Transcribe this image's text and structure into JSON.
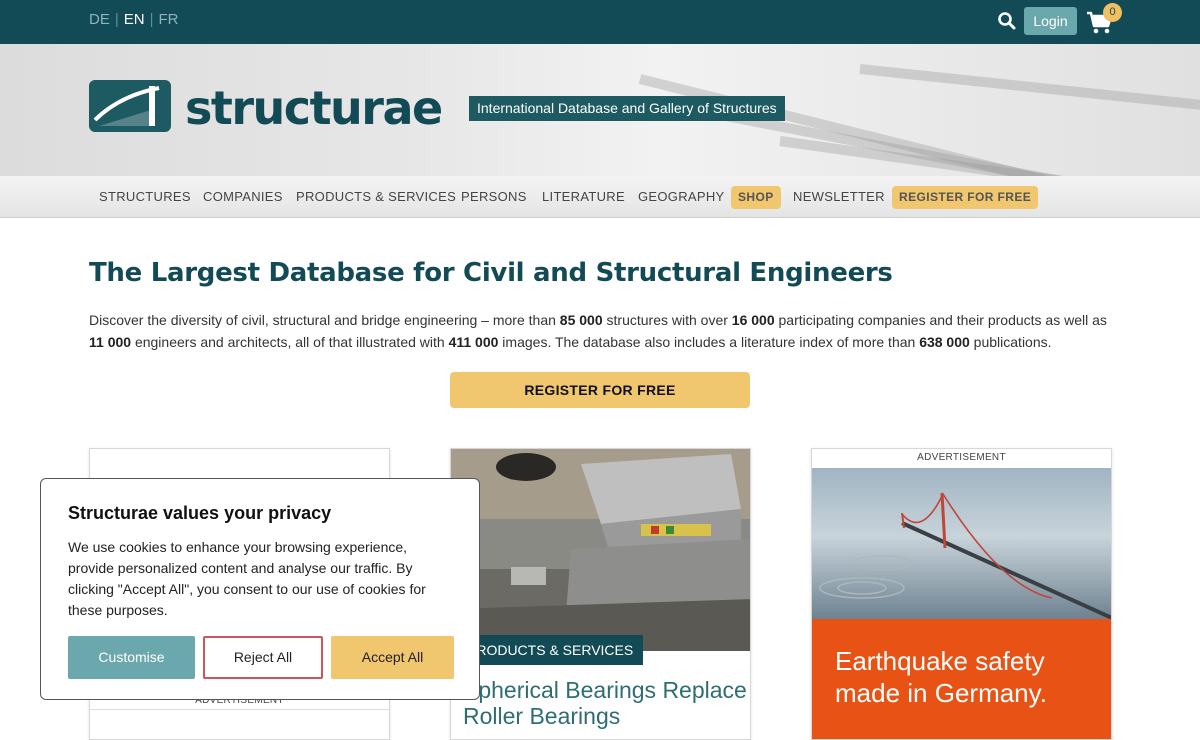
{
  "topbar": {
    "languages": [
      "DE",
      "EN",
      "FR"
    ],
    "active_language": "EN",
    "login_label": "Login",
    "cart_count": "0",
    "search_icon": "search-icon",
    "cart_icon": "cart-icon"
  },
  "banner": {
    "logo_text": "structurae",
    "tagline": "International Database and Gallery of Structures"
  },
  "nav": {
    "items": [
      "STRUCTURES",
      "COMPANIES",
      "PRODUCTS & SERVICES",
      "PERSONS",
      "LITERATURE",
      "GEOGRAPHY",
      "SHOP",
      "NEWSLETTER",
      "REGISTER FOR FREE"
    ]
  },
  "main": {
    "headline": "The Largest Database for Civil and Structural Engineers",
    "intro": {
      "p1": "Discover the diversity of civil, structural and bridge engineering – more than ",
      "n1": "85 000",
      "p2": " structures with over ",
      "n2": "16 000",
      "p3": " participating companies and their products as well as ",
      "n3": "11 000",
      "p4": " engineers and architects, all of that illustrated with ",
      "n4": "411 000",
      "p5": " images. The database also includes a literature index of more than ",
      "n5": "638 000",
      "p6": " publications."
    },
    "register_cta": "REGISTER FOR FREE"
  },
  "cards": {
    "card1_ad_label": "ADVERTISEMENT",
    "card2_tag": "PRODUCTS & SERVICES",
    "card2_title": "Spherical Bearings Replace Roller Bearings",
    "card3_ad_label": "ADVERTISEMENT",
    "card3_slogan": "Earthquake safety made in Germany."
  },
  "cookie": {
    "title": "Structurae values your privacy",
    "text": "We use cookies to enhance your browsing experience, provide personalized content and analyse our traffic. By clicking \"Accept All\", you consent to our use of cookies for these purposes.",
    "customise": "Customise",
    "reject": "Reject All",
    "accept": "Accept All"
  },
  "colors": {
    "brand_teal": "#124a55",
    "accent_gold": "#f0c66e",
    "button_teal": "#6aa8ae",
    "ad_orange": "#e85315"
  }
}
